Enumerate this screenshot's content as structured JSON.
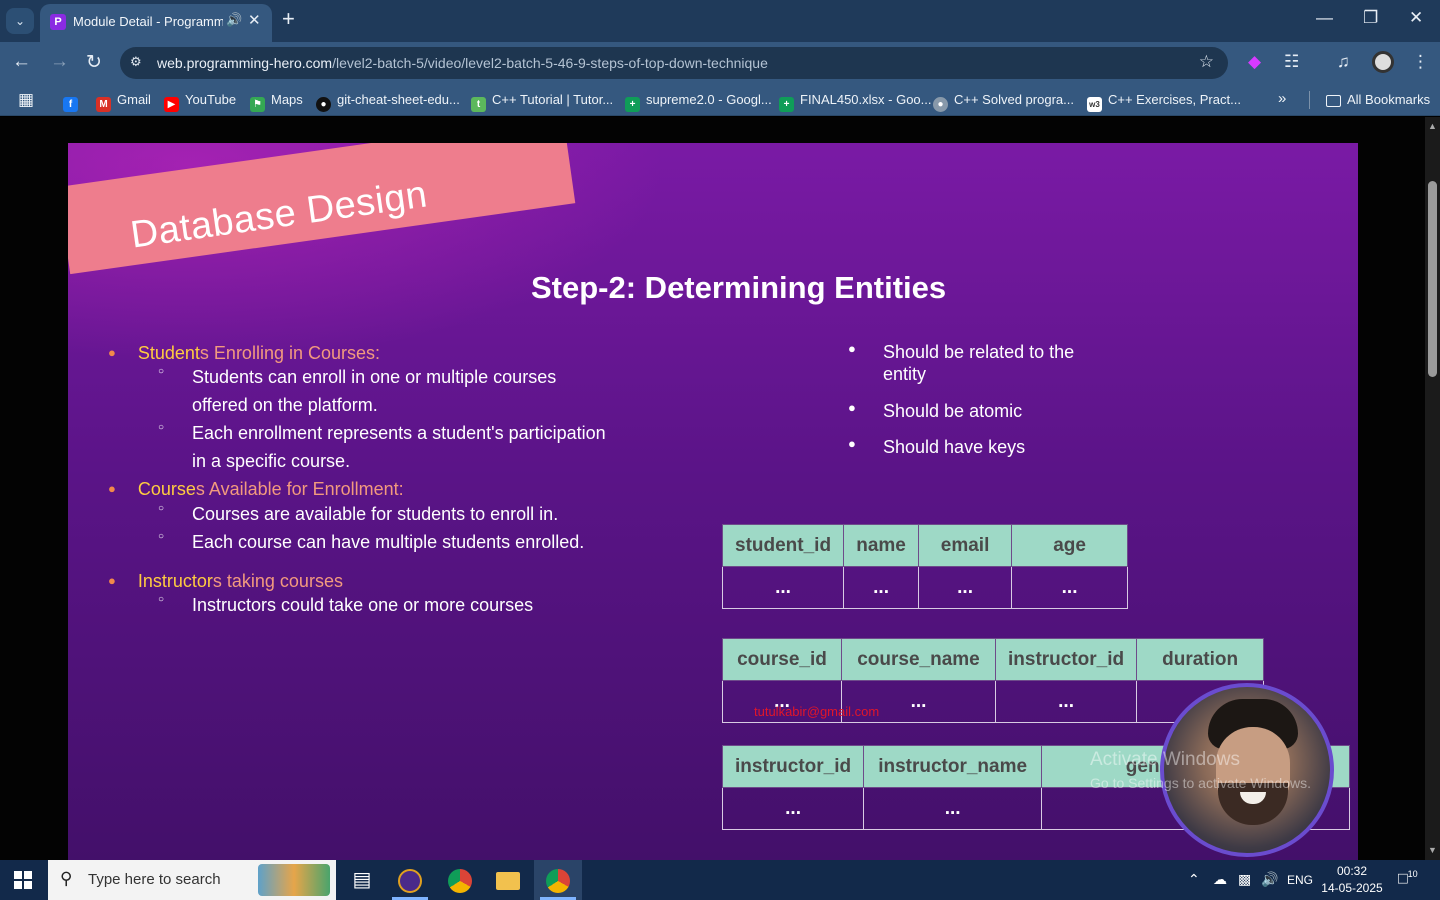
{
  "browser": {
    "tab": {
      "title": "Module Detail - Programming Hero",
      "favicon": "programming-hero-logo"
    },
    "url": {
      "domain": "web.programming-hero.com",
      "path": "/level2-batch-5/video/level2-batch-5-46-9-steps-of-top-down-technique"
    },
    "bookmarks": [
      {
        "label": "",
        "icon": "facebook-icon",
        "color": "#1877f2"
      },
      {
        "label": "Gmail",
        "icon": "gmail-icon",
        "color": "#d93025"
      },
      {
        "label": "YouTube",
        "icon": "youtube-icon",
        "color": "#ff0000"
      },
      {
        "label": "Maps",
        "icon": "maps-icon",
        "color": "#34a853"
      },
      {
        "label": "git-cheat-sheet-edu...",
        "icon": "github-icon",
        "color": "#111111"
      },
      {
        "label": "C++ Tutorial | Tutor...",
        "icon": "tutorial-icon",
        "color": "#5cb85c"
      },
      {
        "label": "supreme2.0 - Googl...",
        "icon": "sheets-icon",
        "color": "#0f9d58"
      },
      {
        "label": "FINAL450.xlsx - Goo...",
        "icon": "sheets-icon",
        "color": "#0f9d58"
      },
      {
        "label": "C++ Solved progra...",
        "icon": "globe-icon",
        "color": "#8899aa"
      },
      {
        "label": "C++ Exercises, Pract...",
        "icon": "w3r-icon",
        "color": "#ffffff"
      }
    ],
    "all_bookmarks": "All Bookmarks"
  },
  "slide": {
    "banner": "Database Design",
    "title": "Step-2: Determining Entities",
    "left_items": [
      {
        "hl": "Student",
        "rest": "s Enrolling in Courses:",
        "subs": [
          "Students can enroll in one or multiple courses offered on the platform.",
          "Each enrollment represents a student's participation in a specific course."
        ]
      },
      {
        "hl": "Course",
        "rest": "s Available for Enrollment:",
        "subs": [
          "Courses are available for students to enroll in.",
          "Each course can have multiple students enrolled."
        ]
      },
      {
        "hl": "Instructor",
        "rest": "s taking courses",
        "subs": [
          "Instructors could take one or more courses"
        ]
      }
    ],
    "right_bullets": [
      "Should be related to the entity",
      "Should be atomic",
      "Should have keys"
    ],
    "tables": [
      {
        "headers": [
          "student_id",
          "name",
          "email",
          "age"
        ],
        "row": [
          "...",
          "...",
          "...",
          "..."
        ]
      },
      {
        "headers": [
          "course_id",
          "course_name",
          "instructor_id",
          "duration"
        ],
        "row": [
          "...",
          "...",
          "...",
          ""
        ]
      },
      {
        "headers": [
          "instructor_id",
          "instructor_name",
          "gender",
          ""
        ],
        "row": [
          "...",
          "...",
          "...",
          ""
        ]
      }
    ],
    "watermark_email": "tutulkabir@gmail.com"
  },
  "activate_windows": {
    "line1": "Activate Windows",
    "line2": "Go to Settings to activate Windows."
  },
  "taskbar": {
    "search_placeholder": "Type here to search",
    "language": "ENG",
    "time": "00:32",
    "date": "14-05-2025",
    "notification_count": "10"
  }
}
